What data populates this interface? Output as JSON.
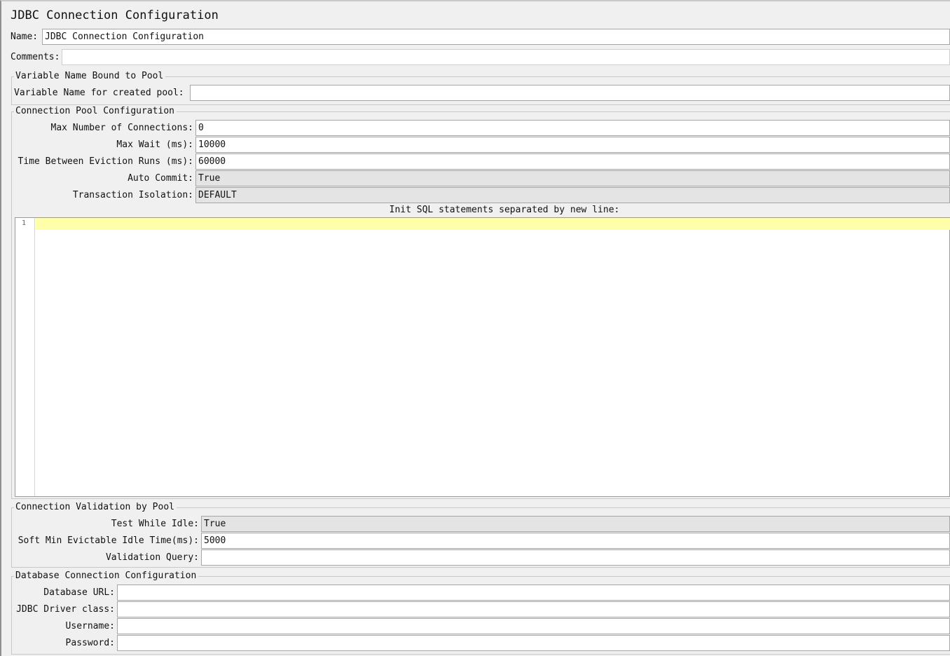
{
  "panel": {
    "title": "JDBC Connection Configuration",
    "name_label": "Name:",
    "name_value": "JDBC Connection Configuration",
    "comments_label": "Comments:",
    "comments_value": ""
  },
  "variable_group": {
    "legend": "Variable Name Bound to Pool",
    "pool_var_label": "Variable Name for created pool:",
    "pool_var_value": ""
  },
  "pool_group": {
    "legend": "Connection Pool Configuration",
    "max_connections_label": "Max Number of Connections:",
    "max_connections_value": "0",
    "max_wait_label": "Max Wait (ms):",
    "max_wait_value": "10000",
    "eviction_label": "Time Between Eviction Runs (ms):",
    "eviction_value": "60000",
    "auto_commit_label": "Auto Commit:",
    "auto_commit_value": "True",
    "isolation_label": "Transaction Isolation:",
    "isolation_value": "DEFAULT",
    "init_sql_label": "Init SQL statements separated by new line:",
    "init_sql_line_number": "1",
    "init_sql_value": ""
  },
  "validation_group": {
    "legend": "Connection Validation by Pool",
    "test_idle_label": "Test While Idle:",
    "test_idle_value": "True",
    "soft_min_label": "Soft Min Evictable Idle Time(ms):",
    "soft_min_value": "5000",
    "validation_query_label": "Validation Query:",
    "validation_query_value": ""
  },
  "db_group": {
    "legend": "Database Connection Configuration",
    "url_label": "Database URL:",
    "url_value": "",
    "driver_label": "JDBC Driver class:",
    "driver_value": "",
    "username_label": "Username:",
    "username_value": "",
    "password_label": "Password:",
    "password_value": ""
  },
  "colors": {
    "background": "#f0f0f0",
    "field_background": "#ffffff",
    "combo_background": "#e4e4e4",
    "current_line_highlight": "#ffffaa"
  }
}
